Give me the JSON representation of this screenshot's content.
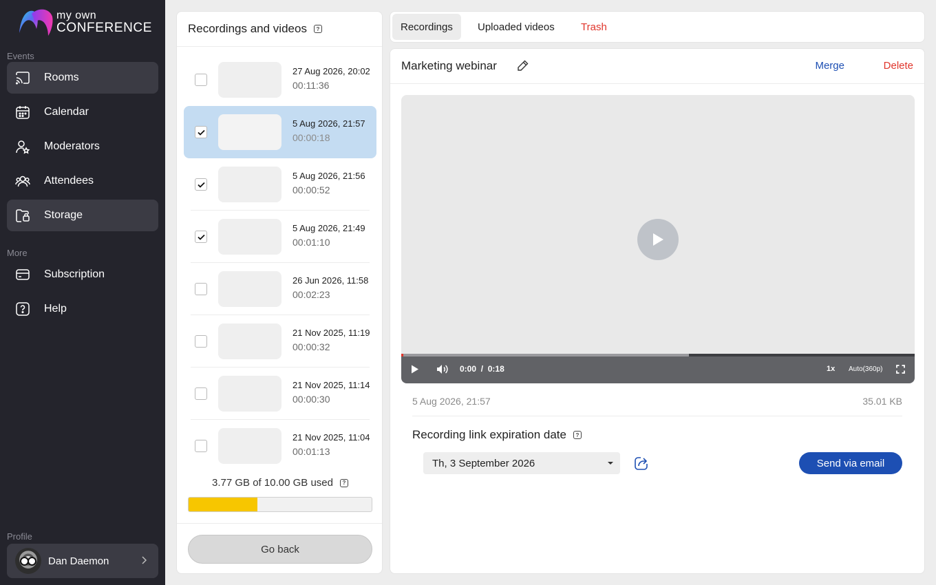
{
  "app": {
    "logo_line1": "my own",
    "logo_line2": "CONFERENCE"
  },
  "sidebar": {
    "events_label": "Events",
    "more_label": "More",
    "profile_label": "Profile",
    "items": [
      {
        "label": "Rooms",
        "icon": "cast-icon",
        "active": true
      },
      {
        "label": "Calendar",
        "icon": "calendar-icon",
        "active": false
      },
      {
        "label": "Moderators",
        "icon": "moderator-icon",
        "active": false
      },
      {
        "label": "Attendees",
        "icon": "attendees-icon",
        "active": false
      },
      {
        "label": "Storage",
        "icon": "storage-folder-icon",
        "active": true
      }
    ],
    "more_items": [
      {
        "label": "Subscription",
        "icon": "card-icon"
      },
      {
        "label": "Help",
        "icon": "help-icon"
      }
    ],
    "profile": {
      "name": "Dan Daemon"
    }
  },
  "list": {
    "title": "Recordings and videos",
    "recordings": [
      {
        "date": "27 Aug 2026, 20:02",
        "duration": "00:11:36",
        "checked": false,
        "selected": false
      },
      {
        "date": "5 Aug 2026, 21:57",
        "duration": "00:00:18",
        "checked": true,
        "selected": true
      },
      {
        "date": "5 Aug 2026, 21:56",
        "duration": "00:00:52",
        "checked": true,
        "selected": false
      },
      {
        "date": "5 Aug 2026, 21:49",
        "duration": "00:01:10",
        "checked": true,
        "selected": false
      },
      {
        "date": "26 Jun 2026, 11:58",
        "duration": "00:02:23",
        "checked": false,
        "selected": false
      },
      {
        "date": "21 Nov 2025, 11:19",
        "duration": "00:00:32",
        "checked": false,
        "selected": false
      },
      {
        "date": "21 Nov 2025, 11:14",
        "duration": "00:00:30",
        "checked": false,
        "selected": false
      },
      {
        "date": "21 Nov 2025, 11:04",
        "duration": "00:01:13",
        "checked": false,
        "selected": false
      }
    ],
    "storage_used_text": "3.77 GB of 10.00 GB used",
    "storage_fraction": 0.377,
    "go_back_label": "Go back"
  },
  "tabs": [
    {
      "label": "Recordings",
      "active": true
    },
    {
      "label": "Uploaded videos",
      "active": false
    },
    {
      "label": "Trash",
      "active": false
    }
  ],
  "detail": {
    "title": "Marketing webinar",
    "merge_label": "Merge",
    "delete_label": "Delete",
    "player": {
      "current_time": "0:00",
      "separator": "/",
      "total_time": "0:18",
      "speed": "1x",
      "quality": "Auto(360p)",
      "buffered_fraction": 0.56
    },
    "recording_date": "5 Aug 2026, 21:57",
    "file_size": "35.01 KB",
    "expiration_label": "Recording link expiration date",
    "expiration_value": "Th, 3 September 2026",
    "send_label": "Send via email"
  },
  "colors": {
    "sidebar_bg": "#24242c",
    "accent_blue": "#1d4fb3",
    "danger_red": "#e0352b",
    "storage_yellow": "#f7c600",
    "selected_row": "#c4dcf2"
  }
}
